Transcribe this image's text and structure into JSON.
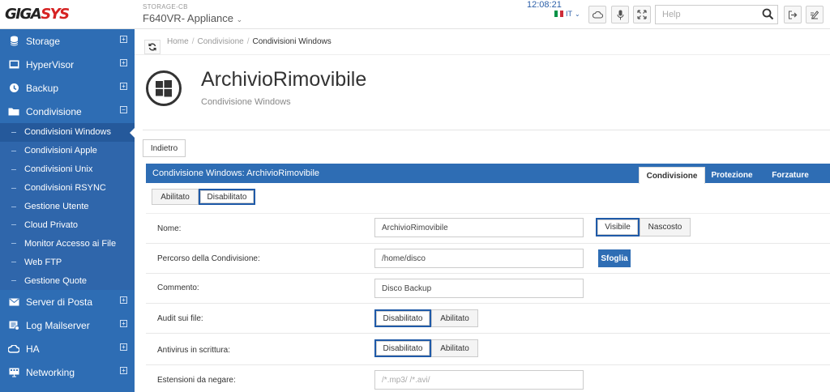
{
  "topbar": {
    "logo_main": "GIGA",
    "logo_accent": "SYS",
    "device_subtitle": "STORAGE-CB",
    "device_name": "F640VR- Appliance",
    "time": "12:08:21",
    "language": "IT",
    "search_placeholder": "Help",
    "flag_colors": [
      "#009246",
      "#ffffff",
      "#ce2b37"
    ]
  },
  "sidebar": {
    "items_top": [
      {
        "label": "Storage",
        "icon": "database-icon",
        "toggle": "⊞"
      },
      {
        "label": "HyperVisor",
        "icon": "server-icon",
        "toggle": "⊞"
      },
      {
        "label": "Backup",
        "icon": "backup-icon",
        "toggle": "⊞"
      },
      {
        "label": "Condivisione",
        "icon": "folder-icon",
        "toggle": "⊟"
      }
    ],
    "subitems": [
      "Condivisioni Windows",
      "Condivisioni Apple",
      "Condivisioni Unix",
      "Condivisioni RSYNC",
      "Gestione Utente",
      "Cloud Privato",
      "Monitor Accesso ai File",
      "Web FTP",
      "Gestione Quote"
    ],
    "items_bottom": [
      {
        "label": "Server di Posta",
        "icon": "mail-icon",
        "toggle": "⊞"
      },
      {
        "label": "Log Mailserver",
        "icon": "log-icon",
        "toggle": "⊞"
      },
      {
        "label": "HA",
        "icon": "cloud-icon",
        "toggle": "⊞"
      },
      {
        "label": "Networking",
        "icon": "network-icon",
        "toggle": "⊞"
      }
    ]
  },
  "breadcrumb": [
    "Home",
    "Condivisione",
    "Condivisioni Windows"
  ],
  "page": {
    "title": "ArchivioRimovibile",
    "subtitle": "Condivisione Windows",
    "back_label": "Indietro"
  },
  "panel": {
    "title": "Condivisione Windows: ArchivioRimovibile",
    "tabs": [
      "Condivisione",
      "Protezione",
      "Forzature"
    ],
    "active_tab": "Condivisione",
    "enable_toggle": {
      "on": "Abilitato",
      "off": "Disabilitato",
      "selected": "Disabilitato"
    }
  },
  "form": {
    "name_label": "Nome:",
    "name_value": "ArchivioRimovibile",
    "visible_label": "Visibile",
    "hidden_label": "Nascosto",
    "path_label": "Percorso della Condivisione:",
    "path_value": "/home/disco",
    "browse_label": "Sfoglia",
    "comment_label": "Commento:",
    "comment_value": "Disco Backup",
    "audit_label": "Audit sui file:",
    "audit_off": "Disabilitato",
    "audit_on": "Abilitato",
    "antivirus_label": "Antivirus in scrittura:",
    "antivirus_off": "Disabilitato",
    "antivirus_on": "Abilitato",
    "extensions_label": "Estensioni da negare:",
    "extensions_placeholder": "/*.mp3/ /*.avi/"
  },
  "colors": {
    "sidebar": "#2e6db4",
    "panel_header": "#2e6db4",
    "selected_outline": "#1f5aa8",
    "logo_accent": "#d62222"
  }
}
